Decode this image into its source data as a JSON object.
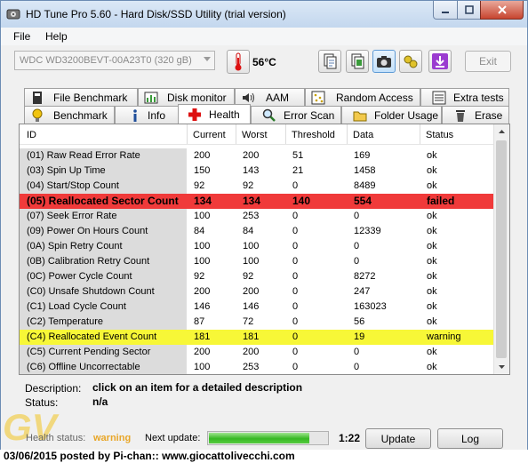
{
  "window": {
    "title": "HD Tune Pro 5.60 - Hard Disk/SSD Utility (trial version)"
  },
  "menu": [
    "File",
    "Help"
  ],
  "toolbar": {
    "drive": "WDC WD3200BEVT-00A23T0 (320 gB)",
    "temperature": "56°C",
    "exit_label": "Exit"
  },
  "tabs_top": [
    "File Benchmark",
    "Disk monitor",
    "AAM",
    "Random Access",
    "Extra tests"
  ],
  "tabs_bottom": [
    "Benchmark",
    "Info",
    "Health",
    "Error Scan",
    "Folder Usage",
    "Erase"
  ],
  "selected_tab": "Health",
  "table": {
    "columns": [
      "ID",
      "Current",
      "Worst",
      "Threshold",
      "Data",
      "Status"
    ],
    "rows": [
      {
        "id": "(01) Raw Read Error Rate",
        "current": "200",
        "worst": "200",
        "threshold": "51",
        "data": "169",
        "status": "ok",
        "state": "ok"
      },
      {
        "id": "(03) Spin Up Time",
        "current": "150",
        "worst": "143",
        "threshold": "21",
        "data": "1458",
        "status": "ok",
        "state": "ok"
      },
      {
        "id": "(04) Start/Stop Count",
        "current": "92",
        "worst": "92",
        "threshold": "0",
        "data": "8489",
        "status": "ok",
        "state": "ok"
      },
      {
        "id": "(05) Reallocated Sector Count",
        "current": "134",
        "worst": "134",
        "threshold": "140",
        "data": "554",
        "status": "failed",
        "state": "failed"
      },
      {
        "id": "(07) Seek Error Rate",
        "current": "100",
        "worst": "253",
        "threshold": "0",
        "data": "0",
        "status": "ok",
        "state": "ok"
      },
      {
        "id": "(09) Power On Hours Count",
        "current": "84",
        "worst": "84",
        "threshold": "0",
        "data": "12339",
        "status": "ok",
        "state": "ok"
      },
      {
        "id": "(0A) Spin Retry Count",
        "current": "100",
        "worst": "100",
        "threshold": "0",
        "data": "0",
        "status": "ok",
        "state": "ok"
      },
      {
        "id": "(0B) Calibration Retry Count",
        "current": "100",
        "worst": "100",
        "threshold": "0",
        "data": "0",
        "status": "ok",
        "state": "ok"
      },
      {
        "id": "(0C) Power Cycle Count",
        "current": "92",
        "worst": "92",
        "threshold": "0",
        "data": "8272",
        "status": "ok",
        "state": "ok"
      },
      {
        "id": "(C0) Unsafe Shutdown Count",
        "current": "200",
        "worst": "200",
        "threshold": "0",
        "data": "247",
        "status": "ok",
        "state": "ok"
      },
      {
        "id": "(C1) Load Cycle Count",
        "current": "146",
        "worst": "146",
        "threshold": "0",
        "data": "163023",
        "status": "ok",
        "state": "ok"
      },
      {
        "id": "(C2) Temperature",
        "current": "87",
        "worst": "72",
        "threshold": "0",
        "data": "56",
        "status": "ok",
        "state": "ok"
      },
      {
        "id": "(C4) Reallocated Event Count",
        "current": "181",
        "worst": "181",
        "threshold": "0",
        "data": "19",
        "status": "warning",
        "state": "warning"
      },
      {
        "id": "(C5) Current Pending Sector",
        "current": "200",
        "worst": "200",
        "threshold": "0",
        "data": "0",
        "status": "ok",
        "state": "ok"
      },
      {
        "id": "(C6) Offline Uncorrectable",
        "current": "100",
        "worst": "253",
        "threshold": "0",
        "data": "0",
        "status": "ok",
        "state": "ok"
      }
    ]
  },
  "description": {
    "label": "Description:",
    "value": "click on an item for a detailed description"
  },
  "status": {
    "label": "Status:",
    "value": "n/a"
  },
  "footer": {
    "health_label": "Health status:",
    "health_value": "warning",
    "next_update_label": "Next update:",
    "next_update_progress": 0.85,
    "next_update_time": "1:22",
    "update_button": "Update",
    "log_button": "Log"
  },
  "watermark": "GV",
  "caption": "03/06/2015 posted by Pi-chan:: www.giocattolivecchi.com",
  "colors": {
    "failed_row": "#f03a3a",
    "warning_row": "#f7f737",
    "health_warning_text": "#e8a628"
  }
}
